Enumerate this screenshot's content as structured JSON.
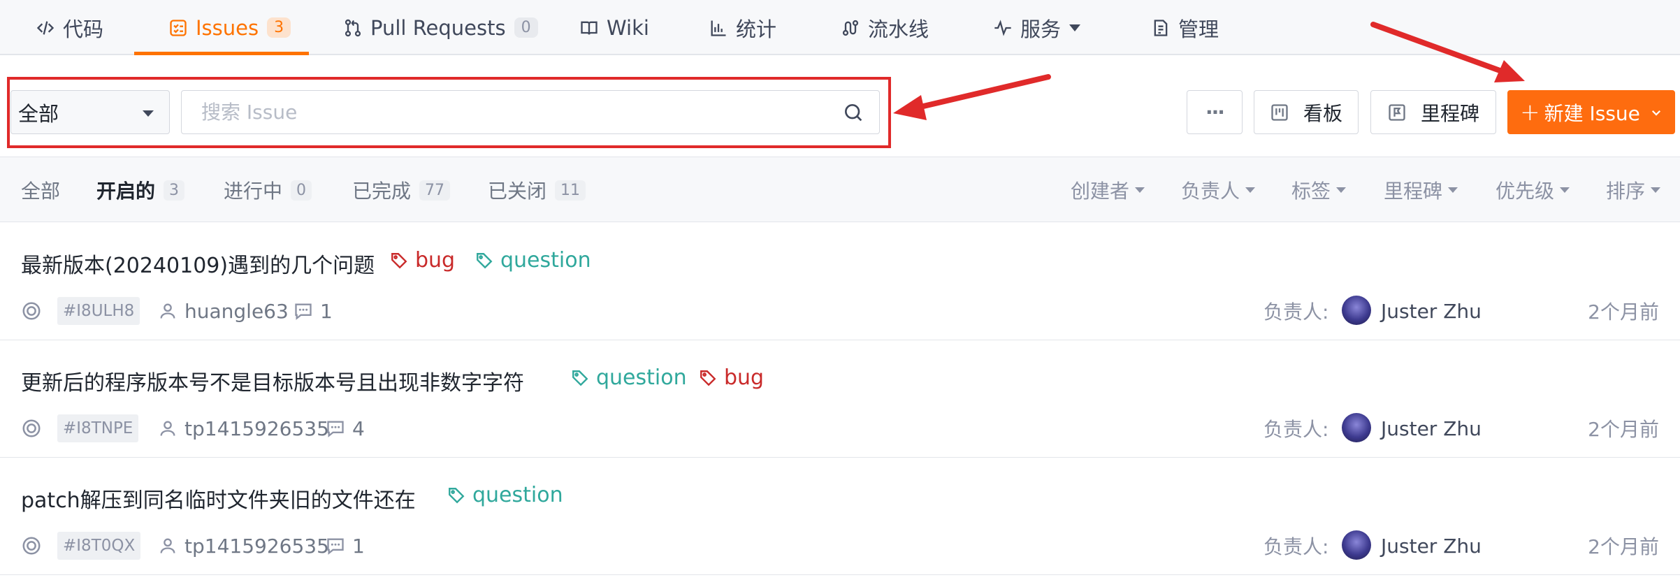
{
  "tabs": [
    {
      "label": "代码",
      "icon": "code-icon"
    },
    {
      "label": "Issues",
      "count": "3",
      "icon": "issues-icon",
      "active": true
    },
    {
      "label": "Pull Requests",
      "count": "0",
      "icon": "pull-request-icon"
    },
    {
      "label": "Wiki",
      "icon": "wiki-icon"
    },
    {
      "label": "统计",
      "icon": "stats-icon"
    },
    {
      "label": "流水线",
      "icon": "pipeline-icon"
    },
    {
      "label": "服务",
      "icon": "service-icon"
    },
    {
      "label": "管理",
      "icon": "manage-icon"
    }
  ],
  "toolbar": {
    "scope_value": "全部",
    "search_placeholder": "搜索 Issue",
    "more_label": "···",
    "board_label": "看板",
    "milestone_label": "里程碑",
    "new_issue_label": "新建 Issue"
  },
  "status_tabs": [
    {
      "label": "全部"
    },
    {
      "label": "开启的",
      "count": "3",
      "active": true
    },
    {
      "label": "进行中",
      "count": "0"
    },
    {
      "label": "已完成",
      "count": "77"
    },
    {
      "label": "已关闭",
      "count": "11"
    }
  ],
  "filters": [
    "创建者",
    "负责人",
    "标签",
    "里程碑",
    "优先级",
    "排序"
  ],
  "issues": [
    {
      "title": "最新版本(20240109)遇到的几个问题",
      "labels": [
        "bug",
        "question"
      ],
      "id": "#I8ULH8",
      "author": "huangle63",
      "comments": "1",
      "assignee_label": "负责人:",
      "assignee": "Juster Zhu",
      "time": "2个月前"
    },
    {
      "title": "更新后的程序版本号不是目标版本号且出现非数字字符",
      "labels": [
        "question",
        "bug"
      ],
      "id": "#I8TNPE",
      "author": "tp1415926535",
      "comments": "4",
      "assignee_label": "负责人:",
      "assignee": "Juster Zhu",
      "time": "2个月前"
    },
    {
      "title": "patch解压到同名临时文件夹旧的文件还在",
      "labels": [
        "question"
      ],
      "id": "#I8T0QX",
      "author": "tp1415926535",
      "comments": "1",
      "assignee_label": "负责人:",
      "assignee": "Juster Zhu",
      "time": "2个月前"
    }
  ],
  "colors": {
    "accent": "#fe7300",
    "new_button": "#fe6c0f",
    "bug_label": "#c92a2a",
    "question_label": "#30a89c",
    "annotation_red": "#e02a2a"
  }
}
